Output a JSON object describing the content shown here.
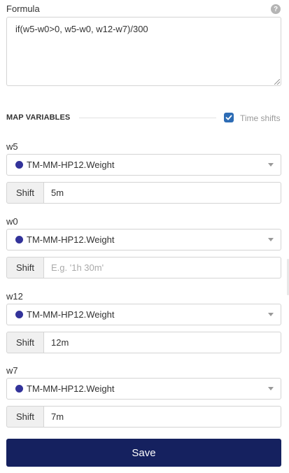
{
  "formula": {
    "label": "Formula",
    "help_icon": "?",
    "value": "if(w5-w0>0, w5-w0, w12-w7)/300"
  },
  "map_variables": {
    "title": "MAP VARIABLES",
    "time_shifts_label": "Time shifts",
    "time_shifts_checked": true
  },
  "variables": [
    {
      "name": "w5",
      "source": "TM-MM-HP12.Weight",
      "dot_color": "#33339a",
      "shift_label": "Shift",
      "shift_value": "5m",
      "shift_placeholder": "E.g. '1h 30m'"
    },
    {
      "name": "w0",
      "source": "TM-MM-HP12.Weight",
      "dot_color": "#33339a",
      "shift_label": "Shift",
      "shift_value": "",
      "shift_placeholder": "E.g. '1h 30m'"
    },
    {
      "name": "w12",
      "source": "TM-MM-HP12.Weight",
      "dot_color": "#33339a",
      "shift_label": "Shift",
      "shift_value": "12m",
      "shift_placeholder": "E.g. '1h 30m'"
    },
    {
      "name": "w7",
      "source": "TM-MM-HP12.Weight",
      "dot_color": "#33339a",
      "shift_label": "Shift",
      "shift_value": "7m",
      "shift_placeholder": "E.g. '1h 30m'"
    }
  ],
  "save_button": {
    "label": "Save"
  },
  "colors": {
    "save_bg": "#15215f",
    "checkbox": "#2d6cb5"
  }
}
